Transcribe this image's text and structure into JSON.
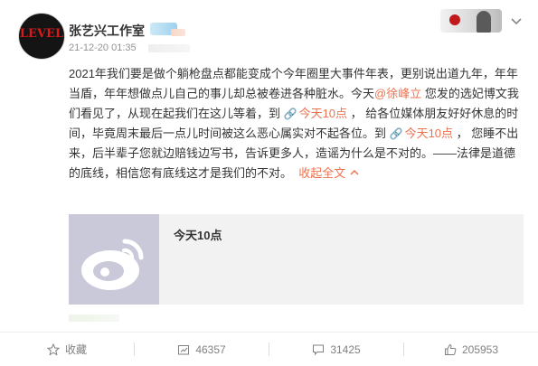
{
  "post": {
    "username": "张艺兴工作室",
    "timestamp": "21-12-20 01:35",
    "avatar_logo": "LEVEL",
    "text": {
      "p1": "2021年我们要是做个躺枪盘点都能变成个今年圈里大事件年表，更别说出道九年，年年当盾，年年想做点儿自己的事儿却总被卷进各种脏水。今天",
      "mention": "@徐峰立",
      "p2": " 您发的选妃博文我们看见了，从现在起我们在这儿等着，到 ",
      "link1": "今天10点",
      "p3": " ， 给各位媒体朋友好好休息的时间，毕竟周末最后一点儿时间被这么恶心属实对不起各位。到 ",
      "link2": "今天10点",
      "p4": " ， 您睡不出来，后半辈子您就边赔钱边写书，告诉更多人，造谣为什么是不对的。——法律是道德的底线，相信您有底线这才是我们的不对。",
      "collapse_label": "收起全文"
    },
    "embed": {
      "title": "今天10点"
    }
  },
  "actions": {
    "favorite_label": "收藏",
    "repost_count": "46357",
    "comment_count": "31425",
    "like_count": "205953"
  },
  "colors": {
    "accent": "#eb7350",
    "muted": "#939393",
    "embed_bg": "#f2f2f2"
  },
  "icons": {
    "options": "chevron-down-icon",
    "link": "link-icon",
    "favorite": "star-icon",
    "repost": "repost-icon",
    "comment": "comment-icon",
    "like": "thumbs-up-icon",
    "embed": "weibo-logo-icon"
  }
}
